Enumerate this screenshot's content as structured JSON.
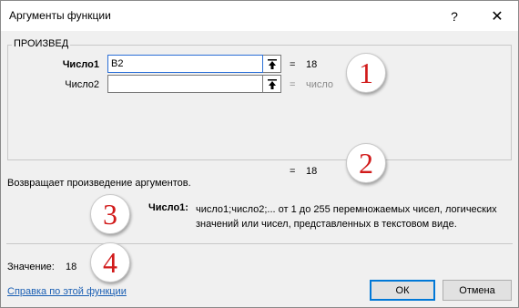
{
  "window": {
    "title": "Аргументы функции",
    "help_glyph": "?",
    "close_glyph": "✕"
  },
  "function_group": {
    "name": "ПРОИЗВЕД",
    "args": [
      {
        "label": "Число1",
        "value": "B2",
        "result": "18"
      },
      {
        "label": "Число2",
        "value": "",
        "result": "число"
      }
    ]
  },
  "formula_result": {
    "equals": "=",
    "value": "18"
  },
  "description": "Возвращает произведение аргументов.",
  "arg_help": {
    "label": "Число1:",
    "text": "число1;число2;... от 1 до 255 перемножаемых чисел, логических значений или чисел, представленных в текстовом виде."
  },
  "value": {
    "label": "Значение:",
    "number": "18"
  },
  "help_link": "Справка по этой функции",
  "buttons": {
    "ok": "ОК",
    "cancel": "Отмена"
  },
  "callouts": [
    "1",
    "2",
    "3",
    "4"
  ],
  "colors": {
    "callout_text": "#d11a1a",
    "link": "#1a5fb4",
    "focus": "#0078d7"
  }
}
